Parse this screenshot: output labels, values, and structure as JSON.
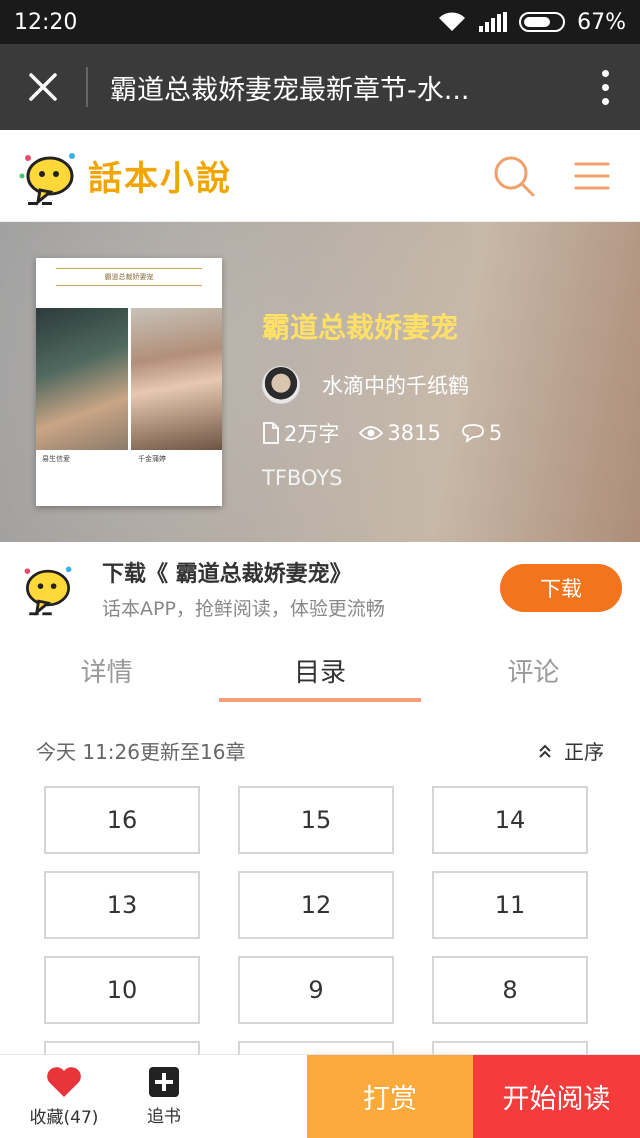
{
  "status_bar": {
    "time": "12:20",
    "battery": "67%"
  },
  "browser": {
    "title": "霸道总裁娇妻宠最新章节-水..."
  },
  "app": {
    "logo_text": "話本小說"
  },
  "book": {
    "title": "霸道总裁娇妻宠",
    "author": "水滴中的千纸鹤",
    "word_count": "2万字",
    "views": "3815",
    "comments": "5",
    "tag": "TFBOYS",
    "cover": {
      "title": "霸道总裁娇妻宠",
      "left_label": "易生信爱",
      "right_label": "千金蒲婷"
    }
  },
  "download_banner": {
    "title": "下载《 霸道总裁娇妻宠》",
    "subtitle": "话本APP，抢鲜阅读，体验更流畅",
    "button": "下载"
  },
  "tabs": [
    {
      "label": "详情"
    },
    {
      "label": "目录"
    },
    {
      "label": "评论"
    }
  ],
  "chapters": {
    "update_text": "今天 11:26更新至16章",
    "sort_label": "正序",
    "items": [
      "16",
      "15",
      "14",
      "13",
      "12",
      "11",
      "10",
      "9",
      "8"
    ]
  },
  "bottom_bar": {
    "favorite_label": "收藏(47)",
    "follow_label": "追书",
    "reward_label": "打赏",
    "read_label": "开始阅读"
  },
  "colors": {
    "accent_orange": "#f2741c",
    "reward": "#fbaa3b",
    "read": "#f43c3c",
    "title_yellow": "#ffe066"
  }
}
